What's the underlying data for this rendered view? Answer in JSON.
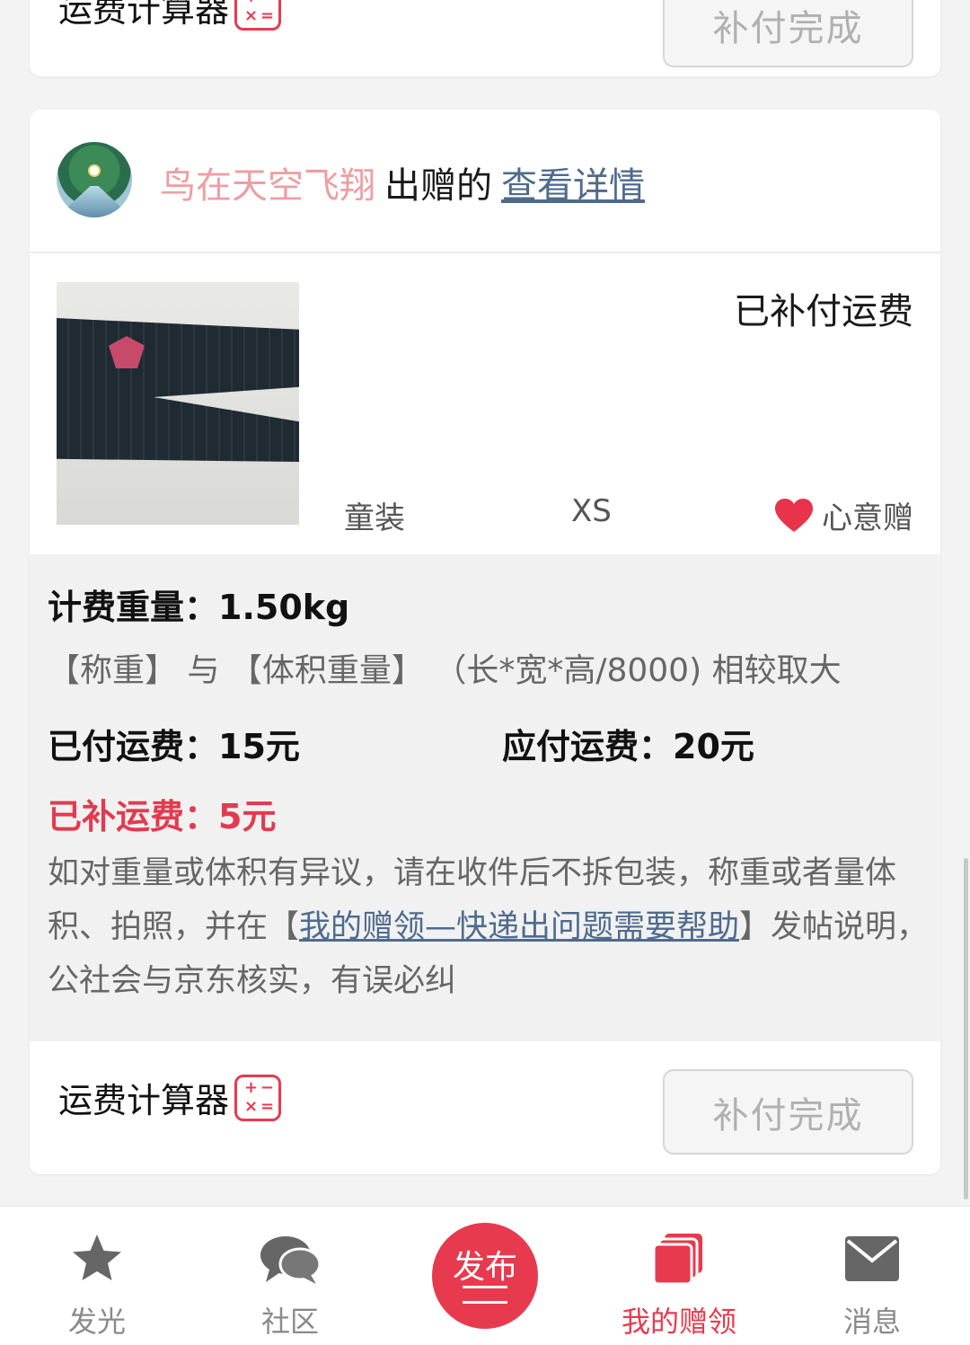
{
  "top_card": {
    "calc_label": "运费计算器",
    "pay_button": "补付完成"
  },
  "order": {
    "giver_name": "鸟在天空飞翔",
    "gave_text": "出赠的",
    "detail_link": "查看详情",
    "status": "已补付运费",
    "category": "童装",
    "size": "XS",
    "gift_type": "心意赠"
  },
  "fees": {
    "weight_label": "计费重量：",
    "weight_value": "1.50kg",
    "weight_rule": "【称重】 与 【体积重量】 （长*宽*高/8000) 相较取大",
    "paid_label": "已付运费：",
    "paid_value": "15元",
    "due_label": "应付运费：",
    "due_value": "20元",
    "supplement_label": "已补运费：",
    "supplement_value": "5元",
    "notice_prefix": "如对重量或体积有异议，请在收件后不拆包装，称重或者量体积、拍照，并在【",
    "notice_link": "我的赠领—快递出问题需要帮助",
    "notice_suffix": "】发帖说明，公社会与京东核实，有误必纠"
  },
  "footer": {
    "calc_label": "运费计算器",
    "pay_button": "补付完成"
  },
  "tabbar": {
    "items": [
      {
        "label": "发光",
        "icon": "star-icon"
      },
      {
        "label": "社区",
        "icon": "chat-bubbles-icon"
      },
      {
        "label": "发布",
        "icon": "publish-icon"
      },
      {
        "label": "我的赠领",
        "icon": "cards-icon"
      },
      {
        "label": "消息",
        "icon": "envelope-icon"
      }
    ],
    "active_index": 3
  },
  "colors": {
    "accent": "#e83a4e",
    "giver_name": "#ef9ea2",
    "link": "#4f6b8c",
    "panel_bg": "#f1f1f1"
  }
}
